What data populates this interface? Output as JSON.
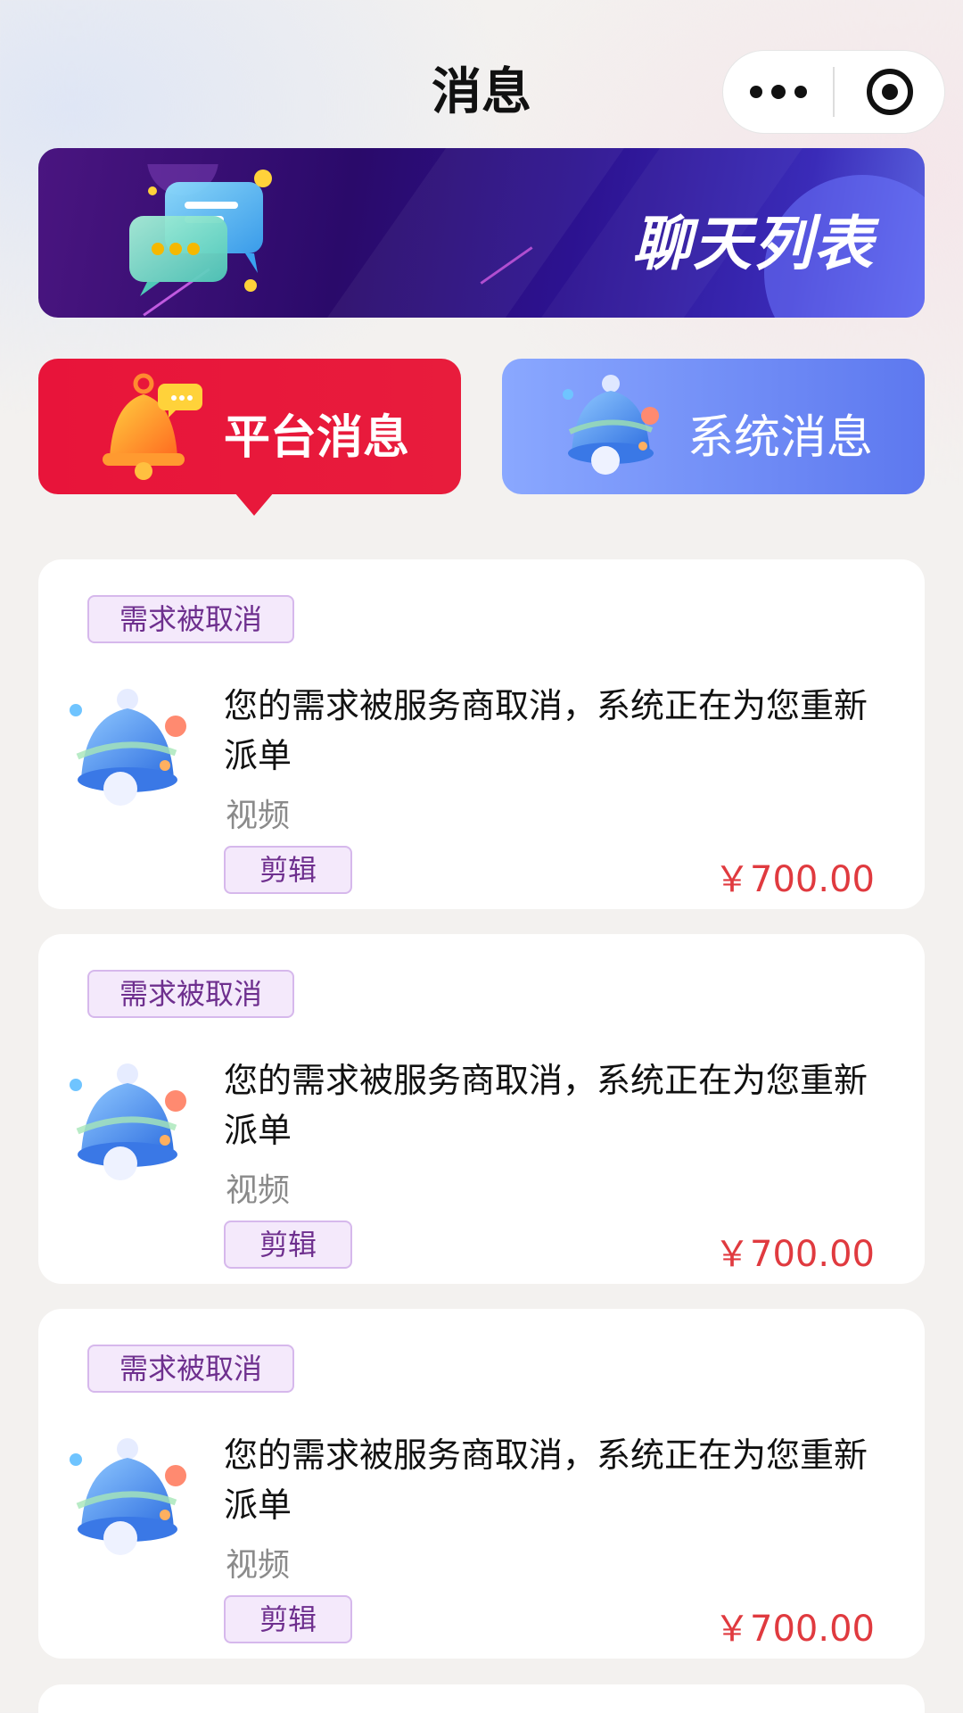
{
  "header": {
    "title": "消息"
  },
  "capsule": {
    "more_icon": "more-dots-icon",
    "close_icon": "target-circle-icon"
  },
  "banner": {
    "title": "聊天列表",
    "icon": "chat-bubbles-icon"
  },
  "tabs": [
    {
      "label": "平台消息",
      "icon": "bell-orange-icon",
      "active": true
    },
    {
      "label": "系统消息",
      "icon": "bell-blue-icon",
      "active": false
    }
  ],
  "messages": [
    {
      "tag": "需求被取消",
      "text": "您的需求被服务商取消，系统正在为您重新派单",
      "category": "视频",
      "skill": "剪辑",
      "price": "￥700.00"
    },
    {
      "tag": "需求被取消",
      "text": "您的需求被服务商取消，系统正在为您重新派单",
      "category": "视频",
      "skill": "剪辑",
      "price": "￥700.00"
    },
    {
      "tag": "需求被取消",
      "text": "您的需求被服务商取消，系统正在为您重新派单",
      "category": "视频",
      "skill": "剪辑",
      "price": "￥700.00"
    }
  ],
  "colors": {
    "accent_red": "#e8143a",
    "system_blue": "#5d78ef",
    "price_red": "#e03a3f",
    "tag_purple": "#6e2f8e"
  }
}
